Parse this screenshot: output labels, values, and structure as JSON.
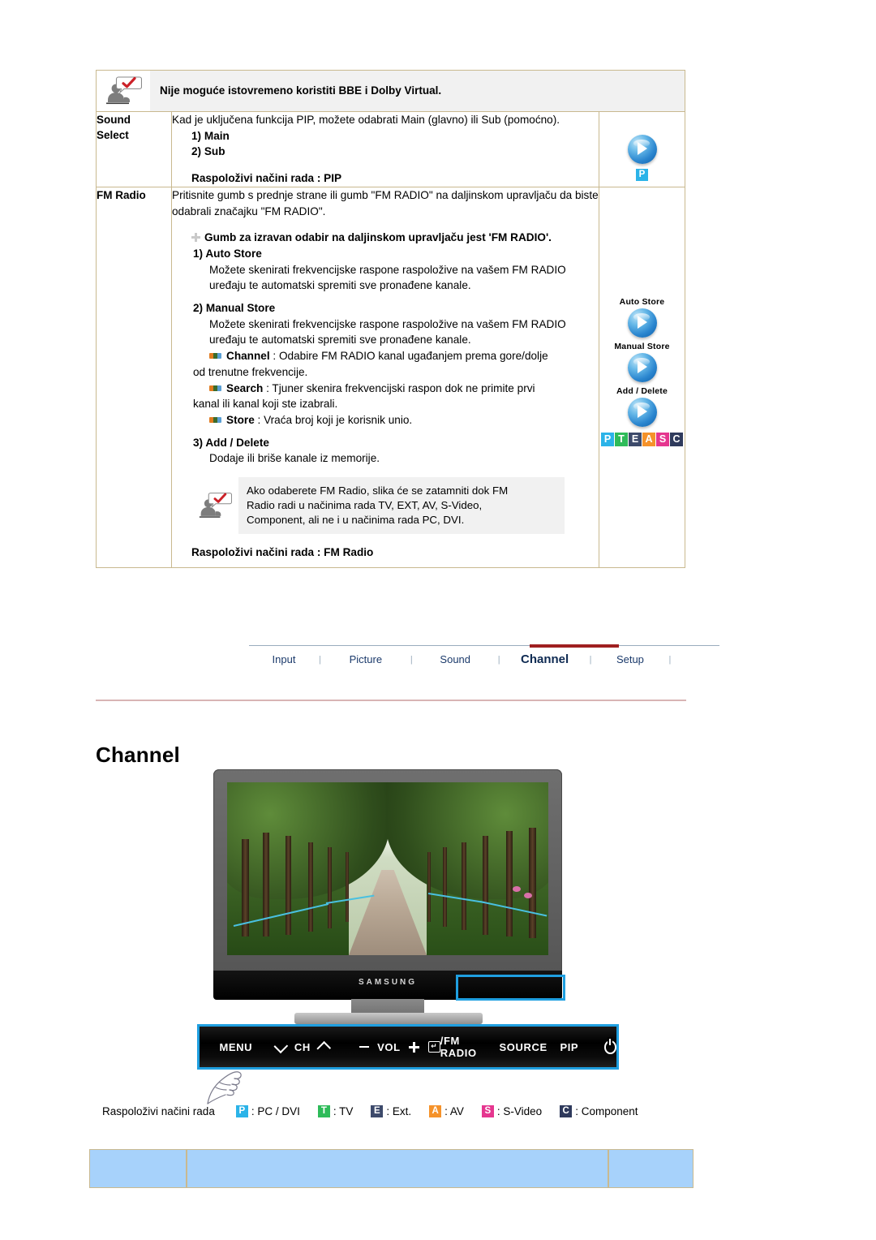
{
  "note_top": {
    "icon": "note-person-check-icon",
    "text": "Nije moguće istovremeno koristiti BBE i Dolby Virtual."
  },
  "table": {
    "rows": [
      {
        "label": "Sound\nSelect",
        "label_line1": "Sound",
        "label_line2": "Select",
        "paragraph": "Kad je uključena funkcija PIP, možete odabrati Main (glavno) ili Sub (pomoćno).",
        "items": [
          "1) Main",
          "2) Sub"
        ],
        "modes_line": "Raspoloživi načini rada : PIP",
        "icons": [
          {
            "name": "blue-play-orb-icon",
            "caption": "",
            "badge": "P",
            "badge_color": "#2bb3e8"
          }
        ]
      },
      {
        "label_line1": "FM Radio",
        "label_line2": "",
        "paragraph": "Pritisnite gumb s prednje strane ili gumb \"FM RADIO\" na daljinskom upravljaču da biste odabrali značajku \"FM RADIO\".",
        "plus_heading": "Gumb za izravan odabir na daljinskom upravljaču jest 'FM RADIO'.",
        "sections": [
          {
            "head": "1) Auto Store",
            "body": "Možete skenirati frekvencijske raspone raspoložive na vašem FM RADIO uređaju te automatski spremiti sve pronađene kanale."
          },
          {
            "head": "2) Manual Store",
            "body": "Možete skenirati frekvencijske raspone raspoložive na vašem FM RADIO uređaju te automatski spremiti sve pronađene kanale.",
            "bullets": [
              {
                "term": "Channel",
                "desc": ": Odabire FM RADIO kanal ugađanjem prema gore/dolje",
                "cont": "od trenutne frekvencije."
              },
              {
                "term": "Search",
                "desc": ": Tjuner skenira frekvencijski raspon dok ne primite prvi",
                "cont": "kanal ili kanal koji ste izabrali."
              },
              {
                "term": "Store",
                "desc": ": Vraća broj koji je korisnik unio.",
                "cont": ""
              }
            ]
          },
          {
            "head": "3) Add / Delete",
            "body": "Dodaje ili briše kanale iz memorije."
          }
        ],
        "inner_note": {
          "icon": "note-person-check-icon",
          "lines": [
            "Ako odaberete FM Radio, slika će se zatamniti dok FM",
            "Radio radi u načinima rada TV, EXT, AV, S-Video,",
            "Component, ali ne i u načinima rada PC, DVI."
          ]
        },
        "modes_line": "Raspoloživi načini rada : FM Radio",
        "icons": [
          {
            "name": "blue-play-orb-icon",
            "caption": "Auto Store"
          },
          {
            "name": "blue-play-orb-icon",
            "caption": "Manual Store"
          },
          {
            "name": "blue-play-orb-icon",
            "caption": "Add / Delete"
          }
        ],
        "badge_row": [
          {
            "letter": "P",
            "color": "#2bb3e8"
          },
          {
            "letter": "T",
            "color": "#2ebb59"
          },
          {
            "letter": "E",
            "color": "#3d4a6b"
          },
          {
            "letter": "A",
            "color": "#f5922a"
          },
          {
            "letter": "S",
            "color": "#e5368f"
          },
          {
            "letter": "C",
            "color": "#2f3a5c"
          }
        ]
      }
    ]
  },
  "nav": {
    "items": [
      {
        "label": "Input",
        "active": false
      },
      {
        "label": "Picture",
        "active": false
      },
      {
        "label": "Sound",
        "active": false
      },
      {
        "label": "Channel",
        "active": true
      },
      {
        "label": "Setup",
        "active": false
      }
    ],
    "separator": "|",
    "active_bar_color": "#9f1f20"
  },
  "page_title": "Channel",
  "monitor": {
    "brand": "SAMSUNG",
    "highlight_color": "#1f9fe0"
  },
  "control_bar": {
    "labels": {
      "menu": "MENU",
      "ch": "CH",
      "vol": "VOL",
      "fm_radio": "/FM RADIO",
      "source": "SOURCE",
      "pip": "PIP"
    },
    "icons": [
      "chevron-down-icon",
      "chevron-up-icon",
      "minus-icon",
      "plus-icon",
      "enter-icon",
      "power-icon"
    ]
  },
  "legend": {
    "label": "Raspoloživi načini rada",
    "items": [
      {
        "letter": "P",
        "color": "#2bb3e8",
        "text": ": PC / DVI"
      },
      {
        "letter": "T",
        "color": "#2ebb59",
        "text": ": TV"
      },
      {
        "letter": "E",
        "color": "#3d4a6b",
        "text": ": Ext."
      },
      {
        "letter": "A",
        "color": "#f5922a",
        "text": ": AV"
      },
      {
        "letter": "S",
        "color": "#e5368f",
        "text": ": S-Video"
      },
      {
        "letter": "C",
        "color": "#2f3a5c",
        "text": ": Component"
      }
    ]
  },
  "footer": {
    "cells": [
      "",
      "",
      ""
    ],
    "color": "#a7d2fb"
  }
}
